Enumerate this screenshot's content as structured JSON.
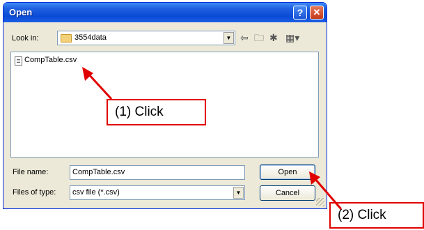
{
  "dialog": {
    "title": "Open",
    "help_btn": "?",
    "close_btn": "✕"
  },
  "lookin": {
    "label": "Look in:",
    "value": "3554data"
  },
  "files": [
    {
      "name": "CompTable.csv"
    }
  ],
  "filename": {
    "label": "File name:",
    "value": "CompTable.csv"
  },
  "filetype": {
    "label": "Files of type:",
    "value": "csv file (*.csv)"
  },
  "buttons": {
    "open": "Open",
    "cancel": "Cancel"
  },
  "annotations": {
    "callout1": "(1) Click",
    "callout2": "(2) Click",
    "arrow_color": "#e00000"
  }
}
